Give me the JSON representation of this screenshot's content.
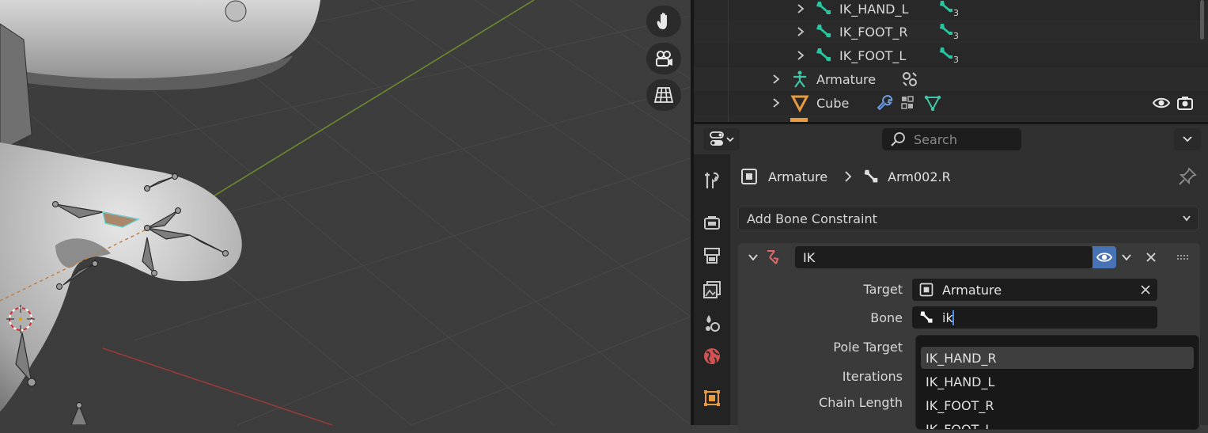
{
  "colors": {
    "viewport_bg": "#3d3d3d",
    "bone_icon": "#26c6a0",
    "armature_icon": "#3fc7a7",
    "mesh_icon": "#e89a3e",
    "accent_blue": "#4772b3",
    "constraint_icon": "#e06a6a"
  },
  "viewport": {
    "nav_icons": [
      "hand-icon",
      "camera-icon",
      "grid-icon"
    ]
  },
  "outliner": {
    "rows": [
      {
        "label": "IK_HAND_L",
        "sub": "3"
      },
      {
        "label": "IK_FOOT_R",
        "sub": "3"
      },
      {
        "label": "IK_FOOT_L",
        "sub": "3"
      },
      {
        "label": "Armature"
      },
      {
        "label": "Cube"
      }
    ]
  },
  "properties": {
    "search_placeholder": "Search",
    "breadcrumb": {
      "object": "Armature",
      "bone": "Arm002.R"
    },
    "add_constraint_label": "Add Bone Constraint",
    "constraint": {
      "name": "IK",
      "target_label": "Target",
      "target_value": "Armature",
      "bone_label": "Bone",
      "bone_value": "ik",
      "pole_target_label": "Pole Target",
      "iterations_label": "Iterations",
      "chain_length_label": "Chain Length"
    }
  },
  "dropdown": {
    "items": [
      "IK_HAND_R",
      "IK_HAND_L",
      "IK_FOOT_R",
      "IK_FOOT_L"
    ],
    "highlighted": "IK_HAND_R"
  }
}
